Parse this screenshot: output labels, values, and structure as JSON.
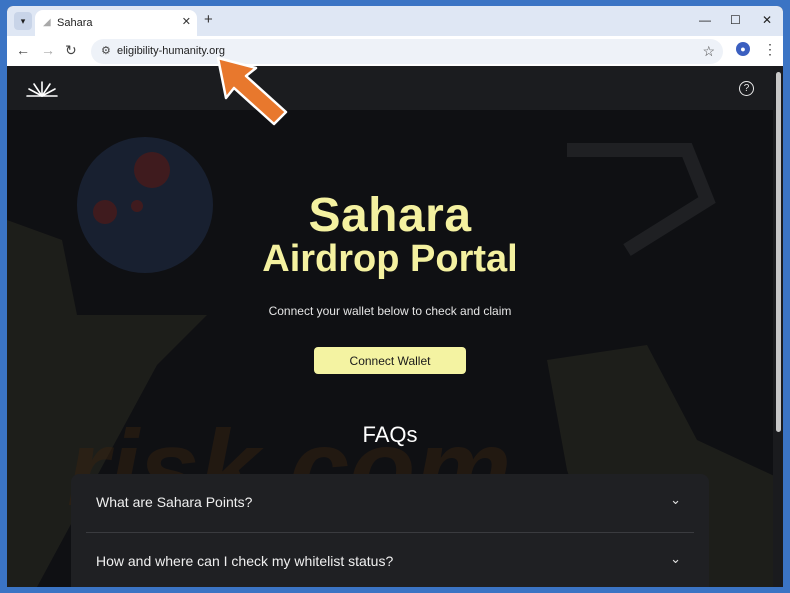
{
  "browser": {
    "tab_title": "Sahara",
    "url": "eligibility-humanity.org",
    "window_controls": [
      "minimize-icon",
      "maximize-icon",
      "close-icon"
    ]
  },
  "site": {
    "hero_line1": "Sahara",
    "hero_line2": "Airdrop Portal",
    "subtitle": "Connect your wallet below to check and claim",
    "cta_label": "Connect Wallet",
    "faq_heading": "FAQs",
    "faqs": [
      {
        "question": "What are Sahara Points?"
      },
      {
        "question": "How and where can I check my whitelist status?"
      }
    ],
    "watermark_text": "risk.com"
  },
  "colors": {
    "accent": "#f4f3a2",
    "page_bg": "#0f1013",
    "annotation_arrow": "#e8782d",
    "browser_frame": "#3b74c4"
  }
}
